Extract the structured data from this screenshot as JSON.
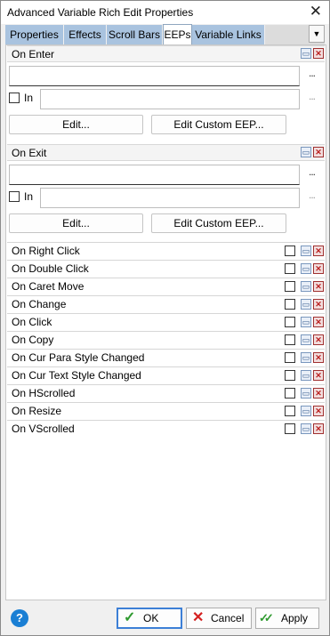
{
  "window": {
    "title": "Advanced Variable Rich Edit Properties",
    "close_glyph": "✕"
  },
  "tabs": [
    {
      "label": "Properties"
    },
    {
      "label": "Effects"
    },
    {
      "label": "Scroll Bars"
    },
    {
      "label": "EEPs"
    },
    {
      "label": "Variable Links"
    }
  ],
  "active_tab": "EEPs",
  "tab_menu_glyph": "▼",
  "sections": [
    {
      "label": "On Enter",
      "value": "",
      "in_label": "In",
      "in_value": "",
      "ellipsis": "...",
      "edit_label": "Edit...",
      "custom_label": "Edit Custom EEP..."
    },
    {
      "label": "On Exit",
      "value": "",
      "in_label": "In",
      "in_value": "",
      "ellipsis": "...",
      "edit_label": "Edit...",
      "custom_label": "Edit Custom EEP..."
    }
  ],
  "events": [
    {
      "label": "On Right Click"
    },
    {
      "label": "On Double Click"
    },
    {
      "label": "On Caret Move"
    },
    {
      "label": "On Change"
    },
    {
      "label": "On Click"
    },
    {
      "label": "On Copy"
    },
    {
      "label": "On Cur Para Style Changed"
    },
    {
      "label": "On Cur Text Style Changed"
    },
    {
      "label": "On HScrolled"
    },
    {
      "label": "On Resize"
    },
    {
      "label": "On VScrolled"
    }
  ],
  "glyphs": {
    "minimize": "▭",
    "delete": "✕",
    "help": "?"
  },
  "buttons": {
    "ok": {
      "label": "OK",
      "icon": "✓"
    },
    "cancel": {
      "label": "Cancel",
      "icon": "✕"
    },
    "apply": {
      "label": "Apply",
      "icon": "✓✓"
    }
  },
  "colors": {
    "tab_bg": "#a9c3df",
    "ok_check": "#2f9a2f",
    "cancel_x": "#d42020",
    "help_bg": "#1a7fd4"
  }
}
